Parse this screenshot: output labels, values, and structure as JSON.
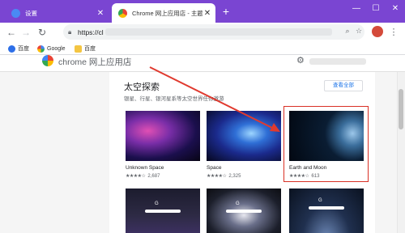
{
  "tabs": [
    {
      "label": "设置",
      "icon": "settings-gear-icon"
    },
    {
      "label": "Chrome 网上应用店 - 主题背景",
      "icon": "webstore-icon"
    }
  ],
  "toolbar": {
    "url_prefix": "https://cl",
    "avatar": "user-avatar"
  },
  "bookmarks": [
    {
      "label": "百度",
      "icon": "baidu-paw-icon"
    },
    {
      "label": "Google",
      "icon": "google-g-icon"
    },
    {
      "label": "百度",
      "icon": "folder-icon"
    }
  ],
  "store": {
    "title": "chrome 网上应用店"
  },
  "section": {
    "title": "太空探索",
    "subtitle": "银星、行星、银河星系等太空世界任你遨游",
    "view_all": "查看全部"
  },
  "themes": [
    {
      "name": "Unknown Space",
      "stars": "★★★★☆",
      "count": "2,687"
    },
    {
      "name": "Space",
      "stars": "★★★★☆",
      "count": "2,325"
    },
    {
      "name": "Earth and Moon",
      "stars": "★★★★☆",
      "count": "613"
    }
  ],
  "colors": {
    "tabstrip": "#7a45d2",
    "highlight": "#d93025",
    "arrow": "#e03a2f",
    "link": "#1a73e8"
  }
}
